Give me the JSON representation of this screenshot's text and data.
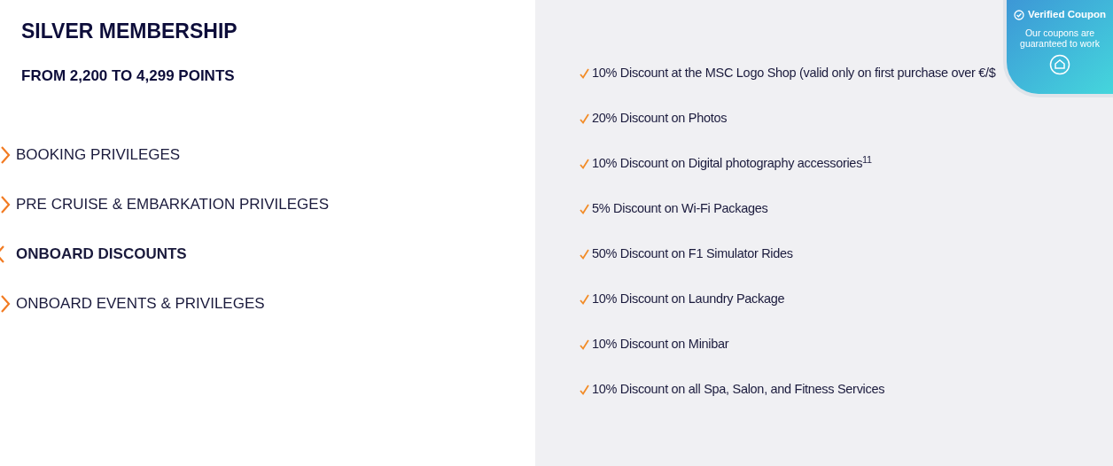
{
  "tier": {
    "title": "SILVER MEMBERSHIP",
    "points": "FROM 2,200 TO 4,299 POINTS"
  },
  "categories": [
    {
      "label": "BOOKING PRIVILEGES",
      "selected": false
    },
    {
      "label": "PRE CRUISE & EMBARKATION PRIVILEGES",
      "selected": false
    },
    {
      "label": "ONBOARD DISCOUNTS",
      "selected": true
    },
    {
      "label": "ONBOARD EVENTS & PRIVILEGES",
      "selected": false
    }
  ],
  "benefits": [
    "10% Discount at the MSC Logo Shop (valid only on first purchase over €/$",
    "20% Discount on Photos",
    "10% Discount on Digital photography accessories$^{11}$",
    "5% Discount on Wi-Fi Packages",
    "50% Discount on F1 Simulator Rides",
    "10% Discount on Laundry Package",
    "10% Discount on Minibar",
    "10% Discount on all Spa, Salon, and Fitness Services"
  ],
  "coupon_badge": {
    "title": "Verified Coupon",
    "text": "Our coupons are guaranteed to work"
  }
}
